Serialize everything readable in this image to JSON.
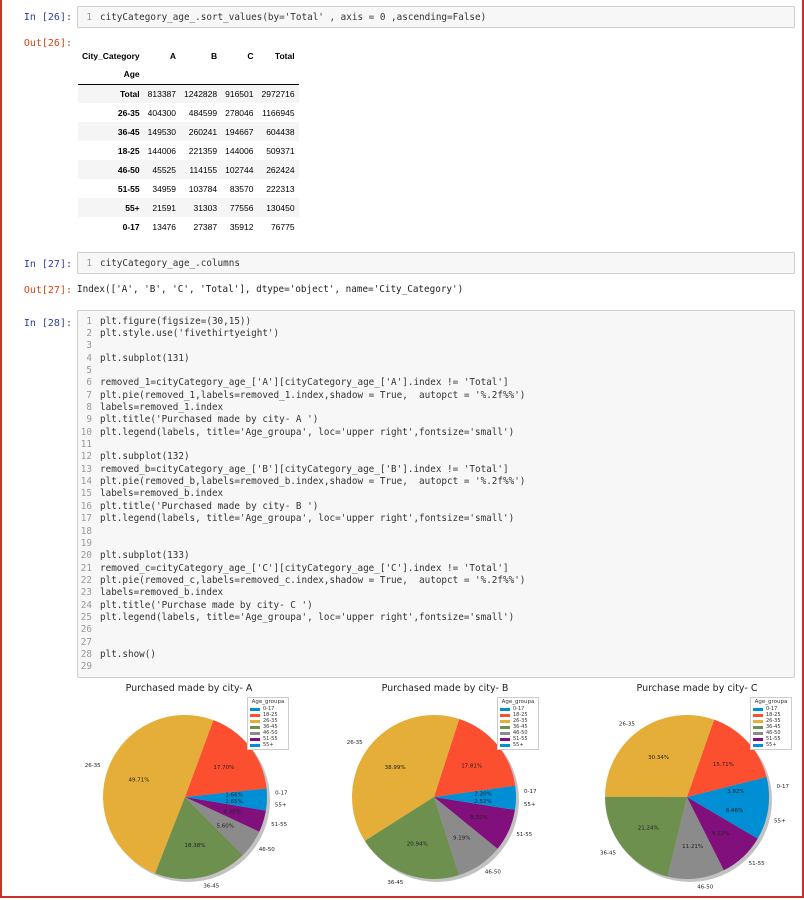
{
  "cells": {
    "c26": {
      "in_prompt": "In [26]:",
      "out_prompt": "Out[26]:",
      "code": [
        "cityCategory_age_.sort_values(by='Total' , axis = 0 ,ascending=False)"
      ]
    },
    "c27": {
      "in_prompt": "In [27]:",
      "out_prompt": "Out[27]:",
      "code": [
        "cityCategory_age_.columns"
      ],
      "output": "Index(['A', 'B', 'C', 'Total'], dtype='object', name='City_Category')"
    },
    "c28": {
      "in_prompt": "In [28]:",
      "code": [
        "plt.figure(figsize=(30,15))",
        "plt.style.use('fivethirtyeight')",
        "",
        "plt.subplot(131)",
        "",
        "removed_1=cityCategory_age_['A'][cityCategory_age_['A'].index != 'Total']",
        "plt.pie(removed_1,labels=removed_1.index,shadow = True,  autopct = '%.2f%%')",
        "labels=removed_1.index",
        "plt.title('Purchased made by city- A ')",
        "plt.legend(labels, title='Age_groupa', loc='upper right',fontsize='small')",
        "",
        "plt.subplot(132)",
        "removed_b=cityCategory_age_['B'][cityCategory_age_['B'].index != 'Total']",
        "plt.pie(removed_b,labels=removed_b.index,shadow = True,  autopct = '%.2f%%')",
        "labels=removed_b.index",
        "plt.title('Purchased made by city- B ')",
        "plt.legend(labels, title='Age_groupa', loc='upper right',fontsize='small')",
        "",
        "",
        "plt.subplot(133)",
        "removed_c=cityCategory_age_['C'][cityCategory_age_['C'].index != 'Total']",
        "plt.pie(removed_c,labels=removed_c.index,shadow = True,  autopct = '%.2f%%')",
        "labels=removed_b.index",
        "plt.title('Purchase made by city- C ')",
        "plt.legend(labels, title='Age_groupa', loc='upper right',fontsize='small')",
        "",
        "",
        "plt.show()",
        ""
      ]
    }
  },
  "table": {
    "col_header_name": "City_Category",
    "index_name": "Age",
    "columns": [
      "A",
      "B",
      "C",
      "Total"
    ],
    "rows": [
      {
        "label": "Total",
        "values": [
          "813387",
          "1242828",
          "916501",
          "2972716"
        ]
      },
      {
        "label": "26-35",
        "values": [
          "404300",
          "484599",
          "278046",
          "1166945"
        ]
      },
      {
        "label": "36-45",
        "values": [
          "149530",
          "260241",
          "194667",
          "604438"
        ]
      },
      {
        "label": "18-25",
        "values": [
          "144006",
          "221359",
          "144006",
          "509371"
        ]
      },
      {
        "label": "46-50",
        "values": [
          "45525",
          "114155",
          "102744",
          "262424"
        ]
      },
      {
        "label": "51-55",
        "values": [
          "34959",
          "103784",
          "83570",
          "222313"
        ]
      },
      {
        "label": "55+",
        "values": [
          "21591",
          "31303",
          "77556",
          "130450"
        ]
      },
      {
        "label": "0-17",
        "values": [
          "13476",
          "27387",
          "35912",
          "76775"
        ]
      }
    ]
  },
  "chart_data": [
    {
      "type": "pie",
      "title": "Purchased made by city- A",
      "legend_title": "Age_groupa",
      "legend_labels": [
        "0-17",
        "18-25",
        "26-35",
        "36-45",
        "46-50",
        "51-55",
        "55+"
      ],
      "legend_position": "upper right",
      "categories": [
        "0-17",
        "18-25",
        "26-35",
        "36-45",
        "46-50",
        "51-55",
        "55+"
      ],
      "values": [
        13476,
        144006,
        404300,
        149530,
        45525,
        34959,
        21591
      ],
      "pct_labels": [
        "1.66%",
        "17.70%",
        "49.71%",
        "18.38%",
        "5.60%",
        "4.30%",
        "2.65%"
      ],
      "shadow": true
    },
    {
      "type": "pie",
      "title": "Purchased made by city- B",
      "legend_title": "Age_groupa",
      "legend_labels": [
        "0-17",
        "18-25",
        "26-35",
        "36-45",
        "46-50",
        "51-55",
        "55+"
      ],
      "legend_position": "upper right",
      "categories": [
        "0-17",
        "18-25",
        "26-35",
        "36-45",
        "46-50",
        "51-55",
        "55+"
      ],
      "values": [
        27387,
        221359,
        484599,
        260241,
        114155,
        103784,
        31303
      ],
      "pct_labels": [
        "2.20%",
        "17.81%",
        "38.99%",
        "20.94%",
        "9.19%",
        "8.35%",
        "2.52%"
      ],
      "shadow": true
    },
    {
      "type": "pie",
      "title": "Purchase made by city- C",
      "legend_title": "Age_groupa",
      "legend_labels": [
        "0-17",
        "18-25",
        "26-35",
        "36-45",
        "46-50",
        "51-55",
        "55+"
      ],
      "legend_position": "upper right",
      "categories": [
        "0-17",
        "18-25",
        "26-35",
        "36-45",
        "46-50",
        "51-55",
        "55+"
      ],
      "values": [
        35912,
        144006,
        278046,
        194667,
        102744,
        83570,
        77556
      ],
      "pct_labels": [
        "3.92%",
        "15.71%",
        "30.34%",
        "21.24%",
        "11.21%",
        "9.12%",
        "8.46%"
      ],
      "shadow": true
    }
  ],
  "colors": {
    "0-17": "#008fd5",
    "18-25": "#fc4f30",
    "26-35": "#e5ae38",
    "36-45": "#6d904f",
    "46-50": "#8b8b8b",
    "51-55": "#810f7c",
    "55+": "#008fd5"
  }
}
